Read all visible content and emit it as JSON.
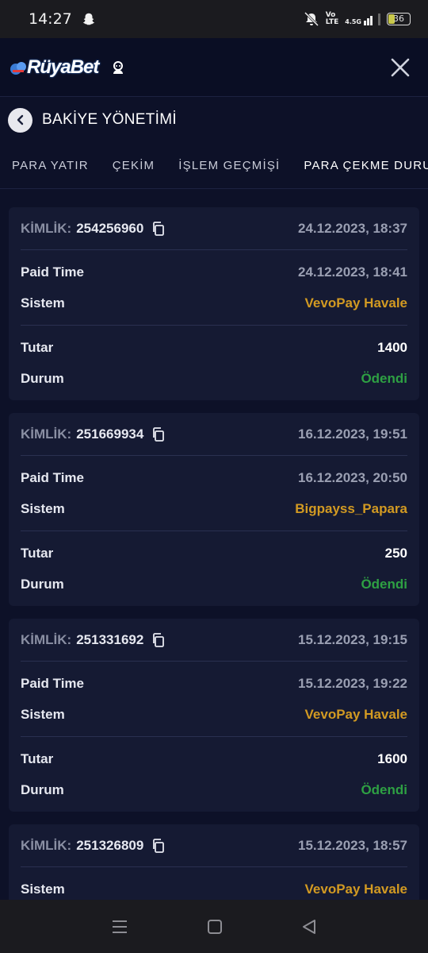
{
  "status_bar": {
    "time": "14:27",
    "network_top": "Vo",
    "network_bottom": "LTE",
    "signal_label": "4.5G",
    "battery": "36"
  },
  "header": {
    "logo_text": "RüyaBet"
  },
  "page": {
    "title": "BAKİYE YÖNETİMİ"
  },
  "tabs": [
    {
      "label": "PARA YATIR"
    },
    {
      "label": "ÇEKİM"
    },
    {
      "label": "İŞLEM GEÇMİŞİ"
    },
    {
      "label": "PARA ÇEKME DURUMU"
    }
  ],
  "labels": {
    "kimlik": "KİMLİK:",
    "paid_time": "Paid Time",
    "sistem": "Sistem",
    "tutar": "Tutar",
    "durum": "Durum"
  },
  "transactions": [
    {
      "id": "254256960",
      "created": "24.12.2023, 18:37",
      "paid_time": "24.12.2023, 18:41",
      "system": "VevoPay Havale",
      "amount": "1400",
      "status": "Ödendi"
    },
    {
      "id": "251669934",
      "created": "16.12.2023, 19:51",
      "paid_time": "16.12.2023, 20:50",
      "system": "Bigpayss_Papara",
      "amount": "250",
      "status": "Ödendi"
    },
    {
      "id": "251331692",
      "created": "15.12.2023, 19:15",
      "paid_time": "15.12.2023, 19:22",
      "system": "VevoPay Havale",
      "amount": "1600",
      "status": "Ödendi"
    },
    {
      "id": "251326809",
      "created": "15.12.2023, 18:57",
      "system": "VevoPay Havale"
    }
  ],
  "colors": {
    "background": "#0d1128",
    "card": "#151a33",
    "system_text": "#d29a22",
    "status_paid": "#2ea043"
  }
}
